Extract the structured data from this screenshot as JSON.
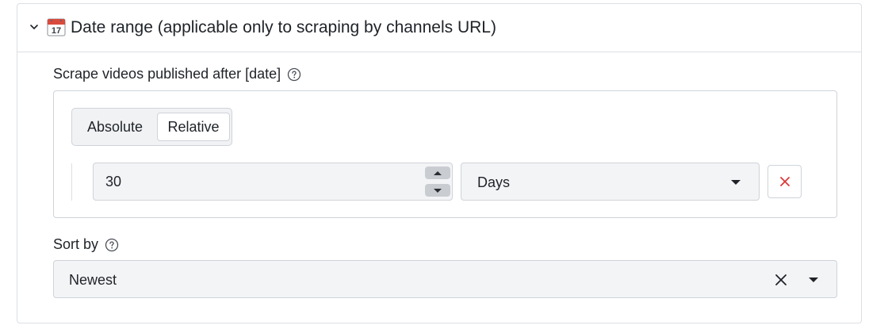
{
  "date_range": {
    "title": "Date range (applicable only to scraping by channels URL)",
    "icon": "calendar-icon",
    "calendar_day": "17",
    "expanded": true
  },
  "published_after": {
    "label": "Scrape videos published after [date]",
    "mode_options": [
      "Absolute",
      "Relative"
    ],
    "selected_mode": "Relative",
    "value": "30",
    "unit": "Days"
  },
  "sort_by": {
    "label": "Sort by",
    "value": "Newest"
  },
  "colors": {
    "remove_red": "#d93a3a",
    "border": "#cfd3d9",
    "field_bg": "#f3f4f6"
  }
}
